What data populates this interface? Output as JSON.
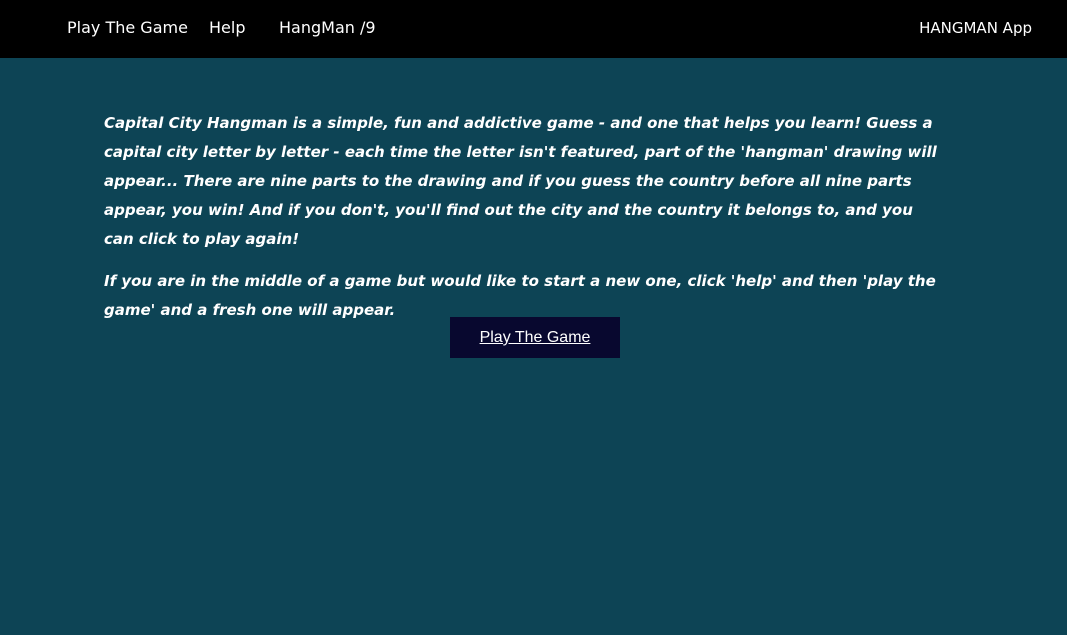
{
  "nav": {
    "links": [
      {
        "label": "Play The Game"
      },
      {
        "label": "Help"
      },
      {
        "label": "HangMan /9"
      }
    ],
    "brand": "HANGMAN App"
  },
  "main": {
    "paragraphs": [
      "Capital City Hangman is a simple, fun and addictive game - and one that helps you learn! Guess a capital city letter by letter - each time the letter isn't featured, part of the 'hangman' drawing will appear... There are nine parts to the drawing and if you guess the country before all nine parts appear, you win! And if you don't, you'll find out the city and the country it belongs to, and you can click to play again!",
      "If you are in the middle of a game but would like to start a new one, click 'help' and then 'play the game' and a fresh one will appear."
    ],
    "play_button": "Play The Game"
  },
  "colors": {
    "background": "#0d4455",
    "navbar": "#000000",
    "button": "#08082f",
    "text": "#ffffff"
  }
}
